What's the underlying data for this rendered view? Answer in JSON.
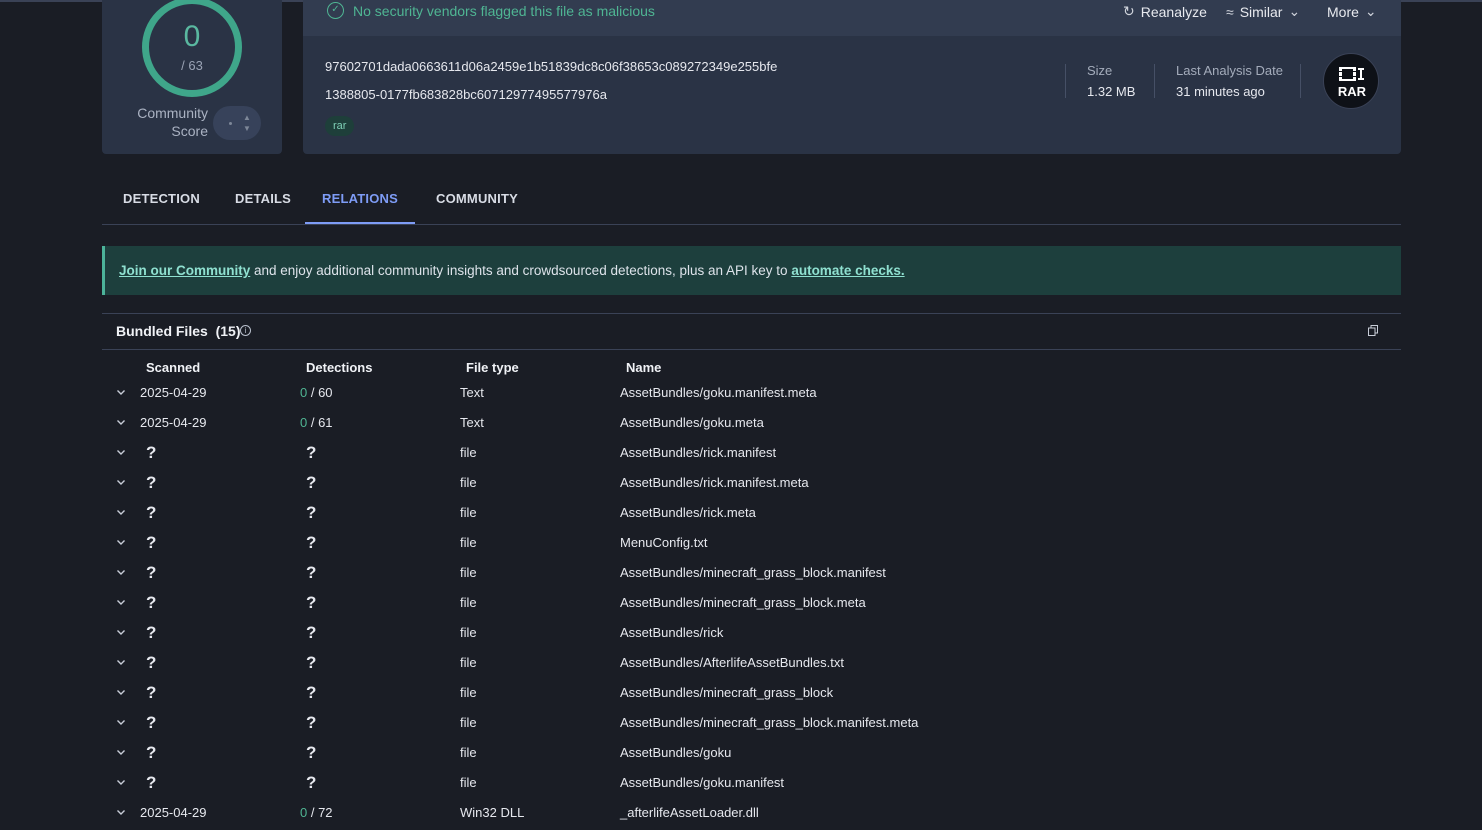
{
  "score": {
    "value": "0",
    "total": "/ 63",
    "community_label": "Community Score"
  },
  "header": {
    "status_text": "No security vendors flagged this file as malicious",
    "status_icon": "check-circle-icon",
    "actions": {
      "reanalyze": "Reanalyze",
      "similar": "Similar",
      "more": "More"
    },
    "hash_sha256": "97602701dada0663611d06a2459e1b51839dc8c06f38653c089272349e255bfe",
    "filename": "1388805-0177fb683828bc607129774955779​76a",
    "tag": "rar",
    "size_label": "Size",
    "size_value": "1.32 MB",
    "last_analysis_label": "Last Analysis Date",
    "last_analysis_value": "31 minutes ago",
    "file_type_badge": "RAR"
  },
  "tabs": [
    "DETECTION",
    "DETAILS",
    "RELATIONS",
    "COMMUNITY"
  ],
  "active_tab": "RELATIONS",
  "banner": {
    "link1": "Join our Community",
    "middle": " and enjoy additional community insights and crowdsourced detections, plus an API key to ",
    "link2": "automate checks."
  },
  "bundled": {
    "title": "Bundled Files",
    "count": "(15)",
    "columns": [
      "Scanned",
      "Detections",
      "File type",
      "Name"
    ],
    "rows": [
      {
        "scanned": "2025-04-29",
        "det_pos": "0",
        "det_total": " / 60",
        "type": "Text",
        "name": "AssetBundles/goku.manifest.meta"
      },
      {
        "scanned": "2025-04-29",
        "det_pos": "0",
        "det_total": " / 61",
        "type": "Text",
        "name": "AssetBundles/goku.meta"
      },
      {
        "scanned": "?",
        "det": "?",
        "type": "file",
        "name": "AssetBundles/rick.manifest"
      },
      {
        "scanned": "?",
        "det": "?",
        "type": "file",
        "name": "AssetBundles/rick.manifest.meta"
      },
      {
        "scanned": "?",
        "det": "?",
        "type": "file",
        "name": "AssetBundles/rick.meta"
      },
      {
        "scanned": "?",
        "det": "?",
        "type": "file",
        "name": "MenuConfig.txt"
      },
      {
        "scanned": "?",
        "det": "?",
        "type": "file",
        "name": "AssetBundles/minecraft_grass_block.manifest"
      },
      {
        "scanned": "?",
        "det": "?",
        "type": "file",
        "name": "AssetBundles/minecraft_grass_block.meta"
      },
      {
        "scanned": "?",
        "det": "?",
        "type": "file",
        "name": "AssetBundles/rick"
      },
      {
        "scanned": "?",
        "det": "?",
        "type": "file",
        "name": "AssetBundles/AfterlifeAssetBundles.txt"
      },
      {
        "scanned": "?",
        "det": "?",
        "type": "file",
        "name": "AssetBundles/minecraft_grass_block"
      },
      {
        "scanned": "?",
        "det": "?",
        "type": "file",
        "name": "AssetBundles/minecraft_grass_block.manifest.meta"
      },
      {
        "scanned": "?",
        "det": "?",
        "type": "file",
        "name": "AssetBundles/goku"
      },
      {
        "scanned": "?",
        "det": "?",
        "type": "file",
        "name": "AssetBundles/goku.manifest"
      },
      {
        "scanned": "2025-04-29",
        "det_pos": "0",
        "det_total": " / 72",
        "type": "Win32 DLL",
        "name": "_afterlifeAssetLoader.dll"
      }
    ]
  }
}
